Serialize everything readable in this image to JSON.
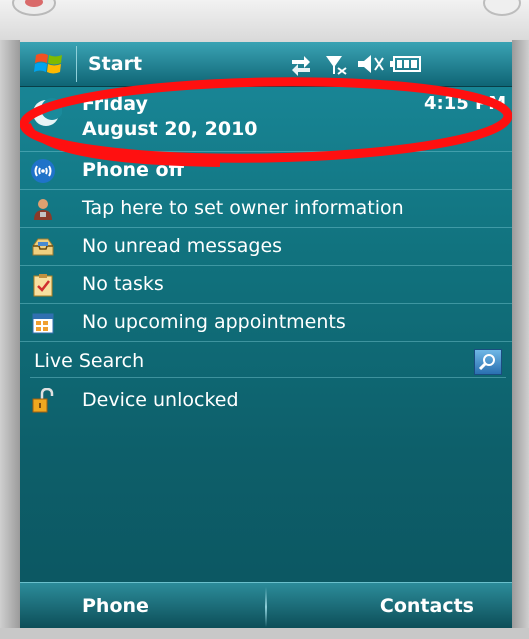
{
  "titlebar": {
    "title": "Start"
  },
  "today": {
    "day": "Friday",
    "date": "August 20, 2010",
    "time": "4:15 PM"
  },
  "items": [
    {
      "label": "Phone off",
      "icon": "phone-signal-icon",
      "bold": true
    },
    {
      "label": "Tap here to set owner information",
      "icon": "owner-person-icon",
      "bold": false
    },
    {
      "label": "No unread messages",
      "icon": "messages-inbox-icon",
      "bold": false
    },
    {
      "label": "No tasks",
      "icon": "tasks-clipboard-icon",
      "bold": false
    },
    {
      "label": "No upcoming appointments",
      "icon": "calendar-icon",
      "bold": false
    }
  ],
  "search": {
    "value": "Live Search",
    "icon": "magnifier-icon"
  },
  "device": {
    "status": "Device unlocked",
    "icon": "unlocked-padlock-icon"
  },
  "softkeys": {
    "left": "Phone",
    "right": "Contacts"
  },
  "colors": {
    "accent": "#0f6f7c",
    "annotation": "#ff1010"
  }
}
